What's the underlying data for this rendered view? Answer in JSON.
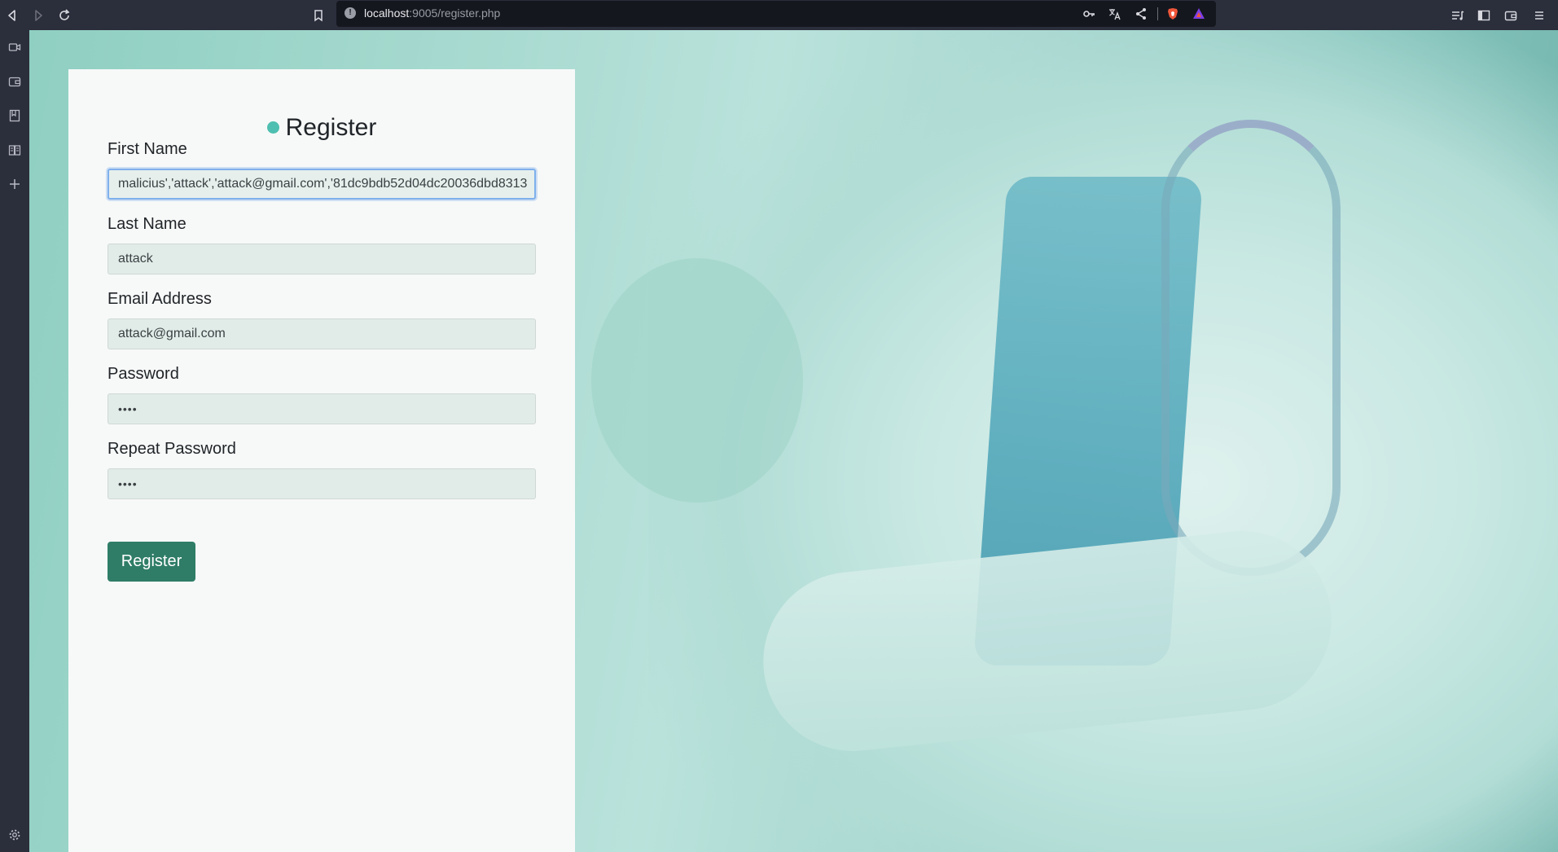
{
  "browser": {
    "url_host": "localhost",
    "url_rest": ":9005/register.php",
    "icons": [
      "back-icon",
      "forward-icon",
      "reload-icon",
      "bookmark-icon",
      "info-icon",
      "key-icon",
      "translate-icon",
      "share-icon",
      "brave-shield-icon",
      "brave-rewards-icon",
      "playlist-icon",
      "sidebar-toggle-icon",
      "wallet-icon",
      "menu-icon"
    ],
    "sidebar_icons": [
      "video-call-icon",
      "wallet-icon",
      "bookmarks-icon",
      "reading-list-icon",
      "add-icon",
      "settings-icon"
    ]
  },
  "form": {
    "title": "Register",
    "accent_color": "#4ebfb0",
    "fields": {
      "first_name": {
        "label": "First Name",
        "value": "malicius','attack','attack@gmail.com','81dc9bdb52d04dc20036dbd8313"
      },
      "last_name": {
        "label": "Last Name",
        "value": "attack"
      },
      "email": {
        "label": "Email Address",
        "value": "attack@gmail.com"
      },
      "password": {
        "label": "Password",
        "value": "••••"
      },
      "repeat_password": {
        "label": "Repeat Password",
        "value": "••••"
      }
    },
    "submit_label": "Register",
    "submit_color": "#2f7d67"
  }
}
